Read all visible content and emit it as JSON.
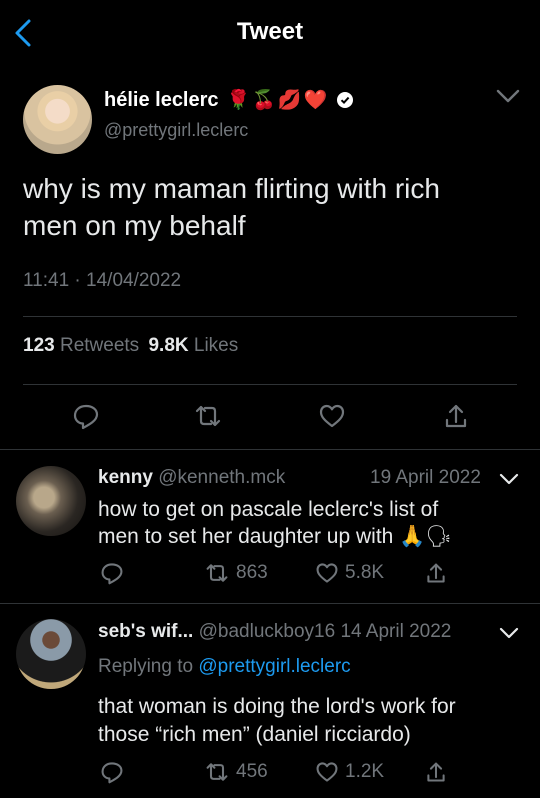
{
  "header": {
    "title": "Tweet"
  },
  "main_tweet": {
    "display_name": "hélie leclerc",
    "name_emojis": "🌹🍒💋❤️",
    "handle": "@prettygirl.leclerc",
    "text_line1": "why is my maman flirting with rich",
    "text_line2": "men on my behalf",
    "time": "11:41",
    "sep": "·",
    "date": "14/04/2022",
    "retweets_count": "123",
    "retweets_label": "Retweets",
    "likes_count": "9.8K",
    "likes_label": "Likes"
  },
  "replies": [
    {
      "name": "kenny",
      "handle": "@kenneth.mck",
      "date": "19 April 2022",
      "line1": "how to get on pascale leclerc's list of",
      "line2": "men to set her daughter up with",
      "emojis": "🙏🗣",
      "retweets": "863",
      "likes": "5.8K"
    },
    {
      "name": "seb's wif...",
      "handle": "@badluckboy16",
      "date": "14 April 2022",
      "replying_prefix": "Replying to",
      "replying_handle": "@prettygirl.leclerc",
      "line1": "that woman is doing the lord's work for",
      "line2": "those “rich men” (daniel ricciardo)",
      "retweets": "456",
      "likes": "1.2K"
    }
  ],
  "colors": {
    "background": "#000000",
    "text": "#e7e9ea",
    "muted": "#71767b",
    "accent": "#1d9bf0",
    "divider": "#2f3336"
  }
}
